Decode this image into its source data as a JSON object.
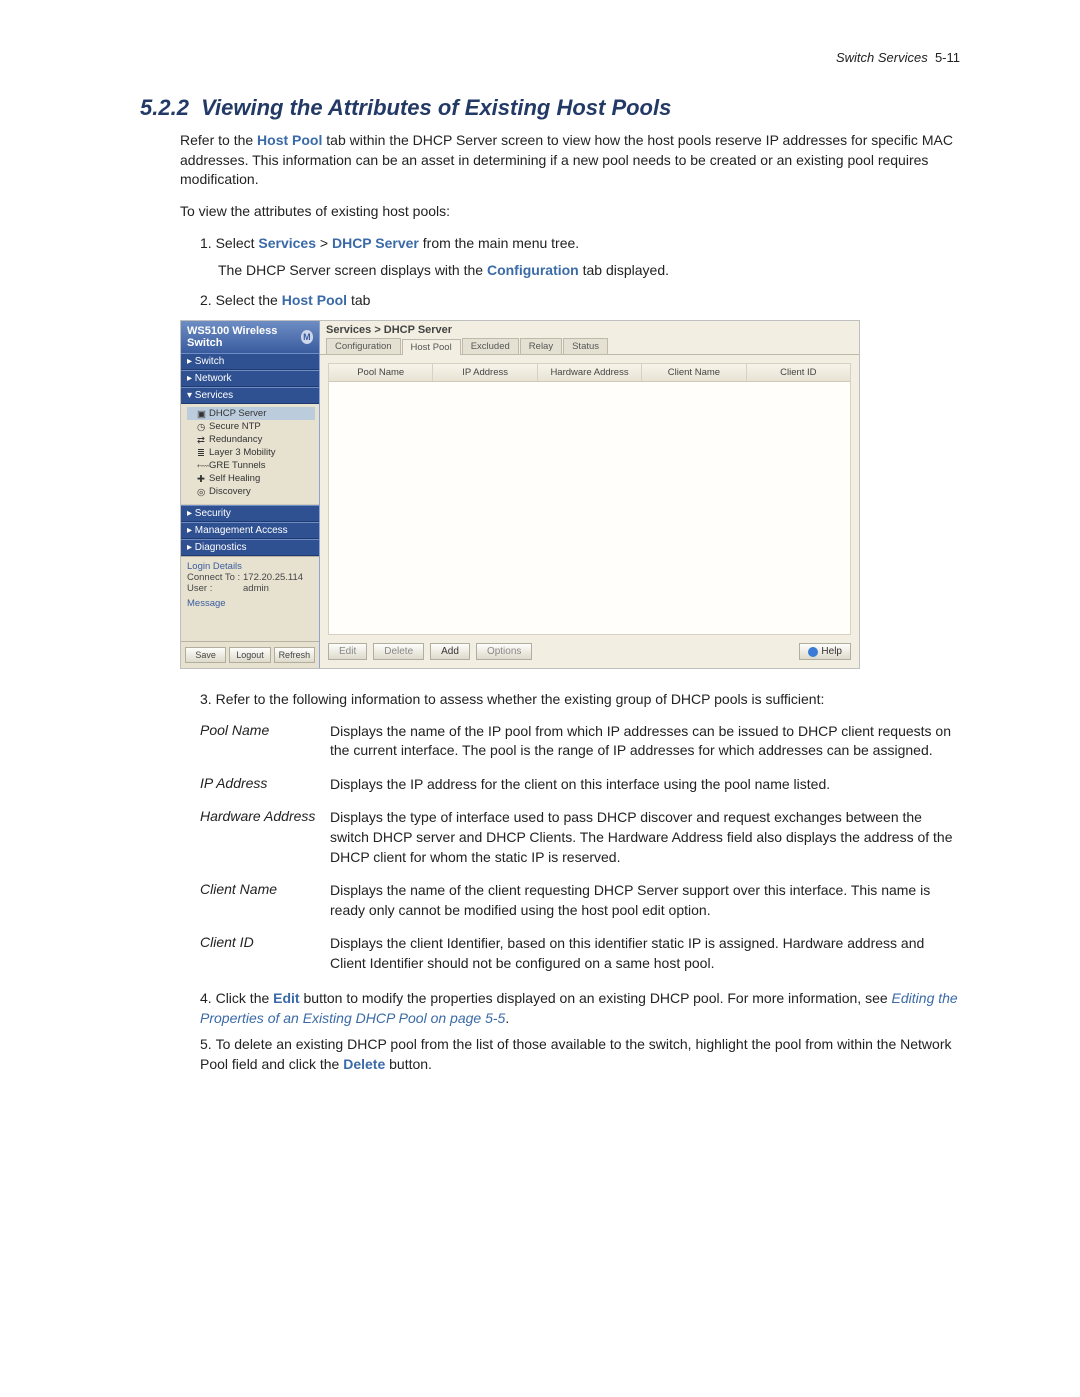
{
  "header": {
    "title": "Switch Services",
    "page": "5-11"
  },
  "section": {
    "number": "5.2.2",
    "title": "Viewing the Attributes of Existing Host Pools"
  },
  "intro": {
    "p1_a": "Refer to the ",
    "p1_host_pool": "Host Pool",
    "p1_b": " tab within the DHCP Server screen to view how the host pools reserve IP addresses for specific MAC addresses. This information can be an asset in determining if a new pool needs to be created or an existing pool requires modification.",
    "p2": "To view the attributes of existing host pools:"
  },
  "steps": {
    "s1_pre": "Select ",
    "s1_services": "Services",
    "s1_sep": " > ",
    "s1_dhcp": "DHCP Server",
    "s1_post": " from the main menu tree.",
    "s1_sub_a": "The DHCP Server screen displays with the ",
    "s1_sub_conf": "Configuration",
    "s1_sub_b": " tab displayed.",
    "s2_a": "Select the ",
    "s2_link": "Host Pool",
    "s2_b": " tab",
    "s3": "Refer to the following information to assess whether the existing group of DHCP pools is sufficient:",
    "s4_a": "Click the ",
    "s4_edit": "Edit",
    "s4_b": " button to modify the properties displayed on an existing DHCP pool. For more information, see ",
    "s4_link": "Editing the Properties of an Existing DHCP Pool on page 5-5",
    "s4_c": ".",
    "s5_a": "To delete an existing DHCP pool from the list of those available to the switch, highlight the pool from within the Network Pool field and click the ",
    "s5_delete": "Delete",
    "s5_b": " button."
  },
  "screenshot": {
    "brand": "WS5100 Wireless Switch",
    "brand_badge": "M",
    "nav": {
      "switch": "▸  Switch",
      "network": "▸  Network",
      "services": "▾  Services"
    },
    "services_items": {
      "dhcp": "DHCP Server",
      "ntp": "Secure NTP",
      "redundancy": "Redundancy",
      "layer3": "Layer 3 Mobility",
      "gre": "GRE Tunnels",
      "selfheal": "Self Healing",
      "discovery": "Discovery"
    },
    "nav2": {
      "security": "▸  Security",
      "mgmt": "▸  Management Access",
      "diag": "▸  Diagnostics"
    },
    "login": {
      "title": "Login Details",
      "connect_lbl": "Connect To :",
      "connect_val": "172.20.25.114",
      "user_lbl": "User :",
      "user_val": "admin",
      "msg_lbl": "Message"
    },
    "sb_buttons": {
      "save": "Save",
      "logout": "Logout",
      "refresh": "Refresh"
    },
    "crumb": "Services > DHCP Server",
    "tabs": {
      "conf": "Configuration",
      "host": "Host Pool",
      "excl": "Excluded",
      "relay": "Relay",
      "status": "Status"
    },
    "columns": {
      "c1": "Pool Name",
      "c2": "IP Address",
      "c3": "Hardware Address",
      "c4": "Client Name",
      "c5": "Client ID"
    },
    "actions": {
      "edit": "Edit",
      "delete": "Delete",
      "add": "Add",
      "options": "Options",
      "help": "Help"
    }
  },
  "descriptions": {
    "pool_name_t": "Pool Name",
    "pool_name_d": "Displays the name of the IP pool from which IP addresses can be issued to DHCP client requests on the current interface. The pool is the range of IP addresses for which addresses can be assigned.",
    "ip_t": "IP Address",
    "ip_d": "Displays the IP address for the client on this interface using the pool name listed.",
    "hw_t": "Hardware Address",
    "hw_d": "Displays the type of interface used to pass DHCP discover and request exchanges between the switch DHCP server and DHCP Clients. The Hardware Address field also displays the address of the DHCP client for whom the static IP is reserved.",
    "cn_t": "Client Name",
    "cn_d": "Displays the name of the client requesting DHCP Server support over this interface. This name is ready only cannot be modified using the host pool edit option.",
    "cid_t": "Client ID",
    "cid_d": "Displays the client Identifier, based on this identifier static IP is assigned. Hardware address and Client Identifier should not be configured on a same host pool."
  }
}
